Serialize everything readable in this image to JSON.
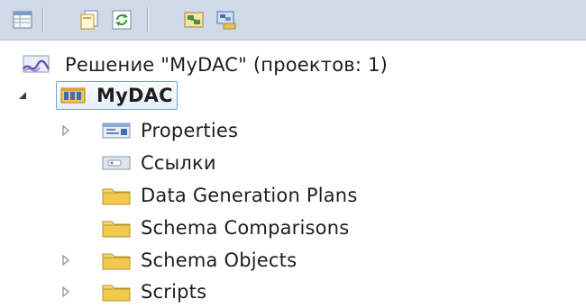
{
  "toolbar": {
    "buttons": [
      {
        "name": "properties-button",
        "icon": "properties-grid-icon"
      },
      {
        "name": "show-all-files-button",
        "icon": "show-all-files-icon"
      },
      {
        "name": "refresh-button",
        "icon": "refresh-icon"
      },
      {
        "name": "schema-view-button",
        "icon": "schema-view-icon"
      },
      {
        "name": "class-view-button",
        "icon": "class-view-icon"
      }
    ]
  },
  "tree": {
    "solution_label": "Решение \"MyDAC\"  (проектов: 1)",
    "project_label": "MyDAC",
    "items": [
      {
        "label": "Properties",
        "icon": "properties-icon",
        "expandable": true
      },
      {
        "label": "Ссылки",
        "icon": "references-icon",
        "expandable": false
      },
      {
        "label": "Data Generation Plans",
        "icon": "folder-icon",
        "expandable": false
      },
      {
        "label": "Schema Comparisons",
        "icon": "folder-icon",
        "expandable": false
      },
      {
        "label": "Schema Objects",
        "icon": "folder-icon",
        "expandable": true
      },
      {
        "label": "Scripts",
        "icon": "folder-icon",
        "expandable": true
      }
    ]
  },
  "colors": {
    "toolbar_bg": "#cfd9e8",
    "folder": "#e8c24a",
    "selection_border": "#7da2ce"
  }
}
